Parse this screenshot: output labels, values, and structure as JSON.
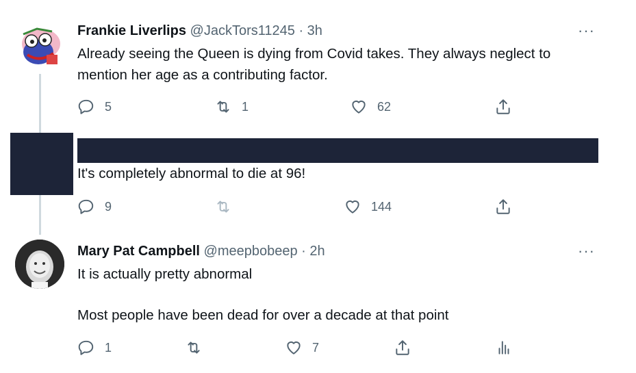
{
  "tweet1": {
    "name": "Frankie Liverlips",
    "handle": "@JackTors11245",
    "time": "· 3h",
    "text_line1": "Already seeing the Queen is dying from Covid takes.  They always neglect to",
    "text_line2": "mention her age as a contributing factor.",
    "replies": "5",
    "retweets": "1",
    "likes": "62",
    "more": "···"
  },
  "tweet2": {
    "text": "It's completely abnormal to die at 96!",
    "replies": "9",
    "likes": "144"
  },
  "tweet3": {
    "name": "Mary Pat Campbell",
    "handle": "@meepbobeep",
    "time": "· 2h",
    "text_line1": "It is actually pretty abnormal",
    "text_line2": "Most people have been dead for over a decade at that point",
    "replies": "1",
    "likes": "7",
    "more": "···"
  },
  "icons": {
    "reply": "reply-icon",
    "retweet": "retweet-icon",
    "like": "heart-icon",
    "share": "share-icon",
    "analytics": "analytics-icon"
  }
}
